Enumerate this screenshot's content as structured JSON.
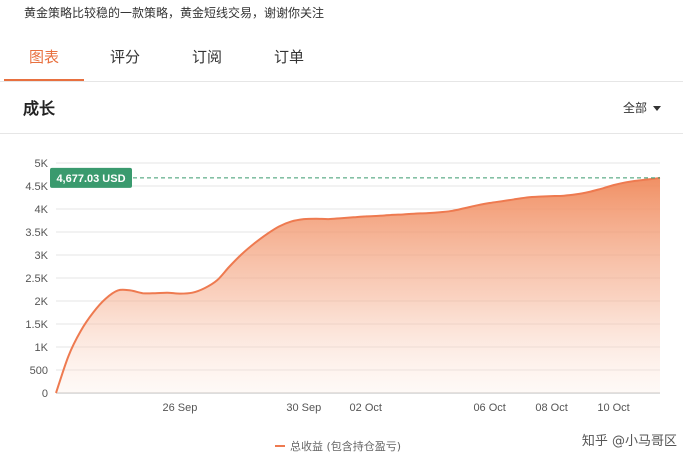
{
  "strategy": {
    "description": "黄金策略比较稳的一款策略，黄金短线交易，谢谢你关注"
  },
  "tabs": [
    {
      "label": "图表",
      "active": true
    },
    {
      "label": "评分",
      "active": false
    },
    {
      "label": "订阅",
      "active": false
    },
    {
      "label": "订单",
      "active": false
    }
  ],
  "section": {
    "title": "成长",
    "range_label": "全部"
  },
  "colors": {
    "accent": "#e8703f",
    "tag_green": "#3a9a6e",
    "line": "#ee7a50"
  },
  "chart_data": {
    "type": "area",
    "y_ticks": [
      "0",
      "500",
      "1K",
      "1.5K",
      "2K",
      "2.5K",
      "3K",
      "3.5K",
      "4K",
      "4.5K",
      "5K"
    ],
    "ylim": [
      0,
      5000
    ],
    "x_ticks": [
      {
        "label": "26 Sep",
        "day": 4
      },
      {
        "label": "30 Sep",
        "day": 8
      },
      {
        "label": "02 Oct",
        "day": 10
      },
      {
        "label": "06 Oct",
        "day": 14
      },
      {
        "label": "08 Oct",
        "day": 16
      },
      {
        "label": "10 Oct",
        "day": 18
      }
    ],
    "xlim": [
      0.0,
      19.5
    ],
    "current_value_label": "4,677.03 USD",
    "current_value": 4677.03,
    "grid": true,
    "series": [
      {
        "name": "总收益 (包含持仓盈亏)",
        "x": [
          0.0,
          0.4,
          0.8,
          1.2,
          1.6,
          2.0,
          2.4,
          2.8,
          3.2,
          3.6,
          4.0,
          4.4,
          4.8,
          5.2,
          5.6,
          6.0,
          6.4,
          6.8,
          7.2,
          7.6,
          8.0,
          8.4,
          8.8,
          9.2,
          9.6,
          10.0,
          10.4,
          10.8,
          11.2,
          11.6,
          12.0,
          12.4,
          12.8,
          13.2,
          13.6,
          14.0,
          14.4,
          14.8,
          15.2,
          15.6,
          16.0,
          16.4,
          16.8,
          17.2,
          17.6,
          18.0,
          18.4,
          18.8,
          19.2,
          19.5
        ],
        "y": [
          0,
          800,
          1350,
          1750,
          2050,
          2230,
          2230,
          2170,
          2170,
          2180,
          2160,
          2180,
          2280,
          2450,
          2750,
          3020,
          3250,
          3450,
          3620,
          3730,
          3780,
          3790,
          3780,
          3800,
          3820,
          3840,
          3850,
          3870,
          3880,
          3900,
          3910,
          3930,
          3960,
          4020,
          4080,
          4130,
          4170,
          4210,
          4250,
          4270,
          4280,
          4290,
          4320,
          4370,
          4440,
          4520,
          4580,
          4620,
          4650,
          4677
        ]
      }
    ]
  },
  "watermark": "知乎 @小马哥区"
}
